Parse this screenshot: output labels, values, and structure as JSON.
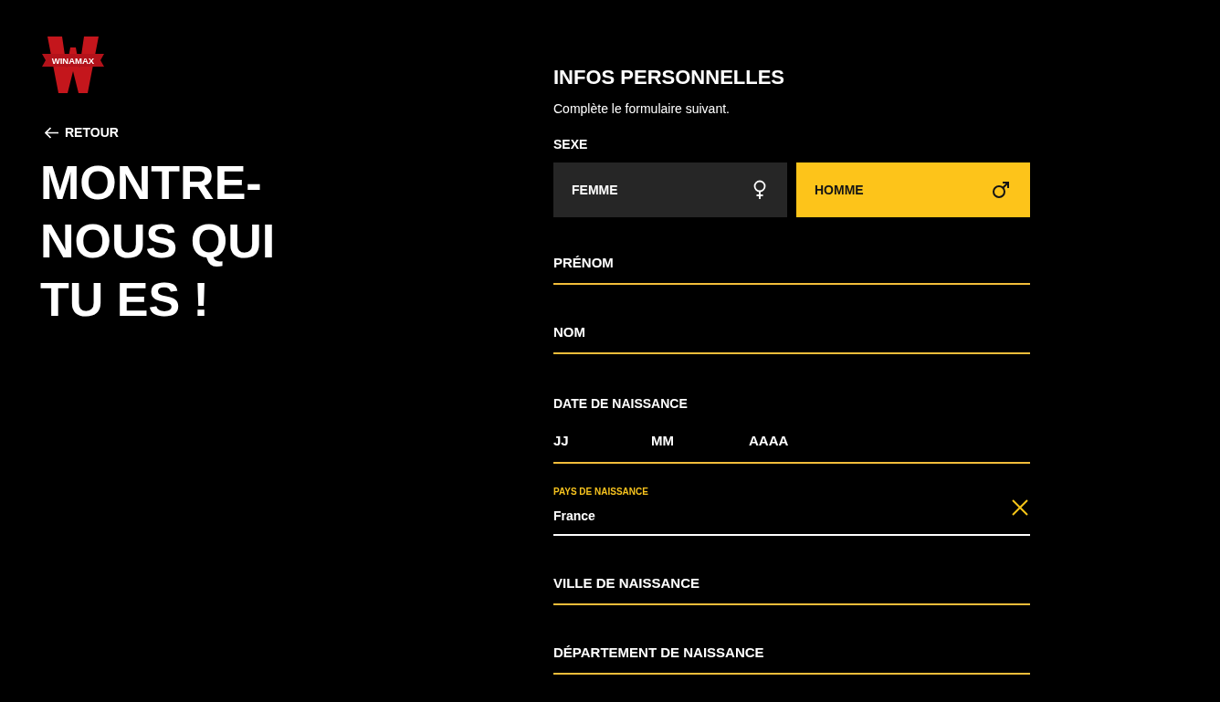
{
  "logo": {
    "text": "WINAMAX"
  },
  "back_link": {
    "label": "RETOUR"
  },
  "heading": "MONTRE-NOUS QUI TU ES !",
  "form": {
    "title": "INFOS PERSONNELLES",
    "subtitle": "Complète le formulaire suivant.",
    "gender": {
      "label": "SEXE",
      "options": [
        {
          "label": "FEMME",
          "kind": "female",
          "selected": false
        },
        {
          "label": "HOMME",
          "kind": "male",
          "selected": true
        }
      ]
    },
    "fields": [
      {
        "kind": "text",
        "placeholder": "PRÉNOM"
      },
      {
        "kind": "text",
        "placeholder": "NOM"
      },
      {
        "kind": "date",
        "label": "DATE DE NAISSANCE",
        "parts": [
          {
            "placeholder": "JJ"
          },
          {
            "placeholder": "MM"
          },
          {
            "placeholder": "AAAA"
          }
        ]
      },
      {
        "kind": "select",
        "label": "PAYS DE NAISSANCE",
        "value": "France"
      },
      {
        "kind": "text",
        "placeholder": "VILLE DE NAISSANCE"
      },
      {
        "kind": "text",
        "placeholder": "DÉPARTEMENT DE NAISSANCE"
      }
    ]
  }
}
